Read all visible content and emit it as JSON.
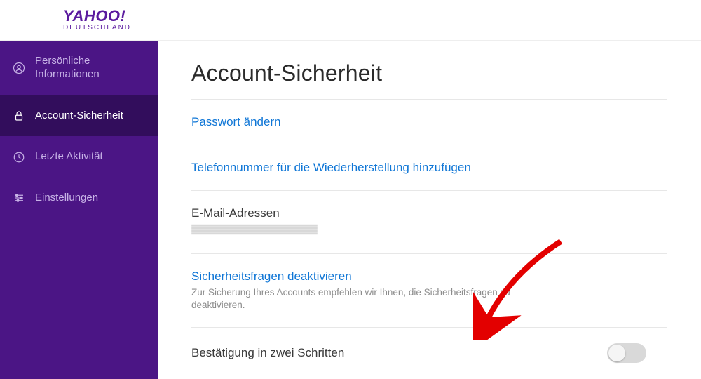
{
  "brand": {
    "name": "YAHOO!",
    "region": "DEUTSCHLAND"
  },
  "sidebar": {
    "items": [
      {
        "label": "Persönliche Informationen",
        "icon": "user-circle-icon",
        "active": false
      },
      {
        "label": "Account-Sicherheit",
        "icon": "lock-icon",
        "active": true
      },
      {
        "label": "Letzte Aktivität",
        "icon": "clock-icon",
        "active": false
      },
      {
        "label": "Einstellungen",
        "icon": "sliders-icon",
        "active": false
      }
    ]
  },
  "main": {
    "title": "Account-Sicherheit",
    "change_password": "Passwort ändern",
    "add_phone": "Telefonnummer für die Wiederherstellung hinzufügen",
    "email_label": "E-Mail-Adressen",
    "sec_q_link": "Sicherheitsfragen deaktivieren",
    "sec_q_desc": "Zur Sicherung Ihres Accounts empfehlen wir Ihnen, die Sicherheitsfragen zu deaktivieren.",
    "two_step_label": "Bestätigung in zwei Schritten",
    "two_step_enabled": false
  },
  "annotation": {
    "arrow_color": "#e30000"
  }
}
